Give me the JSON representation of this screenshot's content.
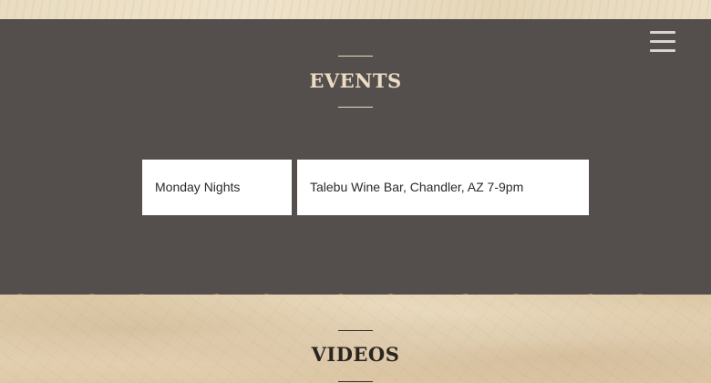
{
  "nav": {
    "menu_icon": "hamburger-menu-icon"
  },
  "events": {
    "title": "EVENTS",
    "items": [
      {
        "date": "Monday Nights",
        "detail": "Talebu Wine Bar, Chandler, AZ 7-9pm"
      }
    ]
  },
  "videos": {
    "title": "VIDEOS"
  },
  "colors": {
    "events_background": "#544f4d",
    "events_title": "#ecdcc3",
    "videos_title": "#2b2522",
    "parchment": "#e6d5b8"
  }
}
